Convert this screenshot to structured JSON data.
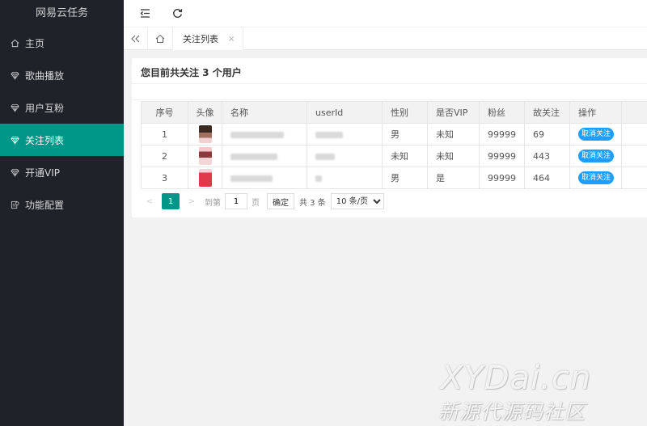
{
  "app": {
    "title": "网易云任务"
  },
  "sidebar": {
    "items": [
      {
        "label": "主页",
        "icon": "home-icon"
      },
      {
        "label": "歌曲播放",
        "icon": "diamond-icon"
      },
      {
        "label": "用户互粉",
        "icon": "diamond-icon"
      },
      {
        "label": "关注列表",
        "icon": "diamond-icon",
        "active": true
      },
      {
        "label": "开通VIP",
        "icon": "diamond-icon"
      },
      {
        "label": "功能配置",
        "icon": "settings-icon"
      }
    ]
  },
  "header": {
    "menu_icon": "menu-fold-icon",
    "refresh_icon": "refresh-icon"
  },
  "tabs": {
    "active_label": "关注列表",
    "close": "×"
  },
  "card": {
    "title": "您目前共关注 3 个用户"
  },
  "table": {
    "headers": [
      "序号",
      "头像",
      "名称",
      "userId",
      "性别",
      "是否VIP",
      "粉丝",
      "故关注",
      "操作"
    ],
    "rows": [
      {
        "index": "1",
        "gender": "男",
        "vip": "未知",
        "fans": "99999",
        "follows": "69",
        "action": "取消关注"
      },
      {
        "index": "2",
        "gender": "未知",
        "vip": "未知",
        "fans": "99999",
        "follows": "443",
        "action": "取消关注"
      },
      {
        "index": "3",
        "gender": "男",
        "vip": "是",
        "fans": "99999",
        "follows": "464",
        "action": "取消关注"
      }
    ]
  },
  "pager": {
    "prev": "<",
    "current": "1",
    "next": ">",
    "goto_label": "到第",
    "goto_value": "1",
    "page_unit": "页",
    "confirm": "确定",
    "total": "共 3 条",
    "page_size": "10 条/页"
  },
  "watermark": {
    "line1": "XYDai.cn",
    "line2": "新源代源码社区"
  },
  "colors": {
    "sidebar_bg": "#20222a",
    "active": "#009688",
    "button_blue": "#1e9fff"
  }
}
